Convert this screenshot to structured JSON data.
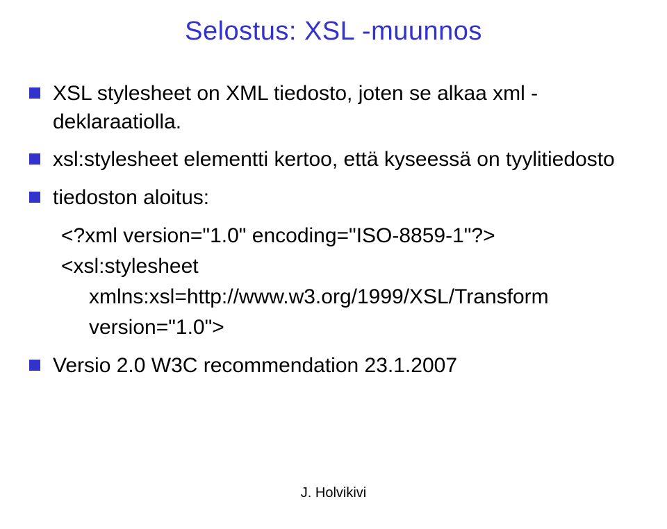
{
  "title": "Selostus: XSL -muunnos",
  "bullets": {
    "b1": "XSL stylesheet on XML tiedosto, joten se alkaa xml -deklaraatiolla.",
    "b2": "xsl:stylesheet elementti kertoo, että kyseessä on tyylitiedosto",
    "b3": "tiedoston aloitus:",
    "b4": "Versio 2.0 W3C recommendation 23.1.2007"
  },
  "code": {
    "line1": "<?xml version=\"1.0\" encoding=\"ISO-8859-1\"?>",
    "line2": "<xsl:stylesheet",
    "line3": "xmlns:xsl=http://www.w3.org/1999/XSL/Transform",
    "line4": "version=\"1.0\">"
  },
  "footer": "J. Holvikivi"
}
